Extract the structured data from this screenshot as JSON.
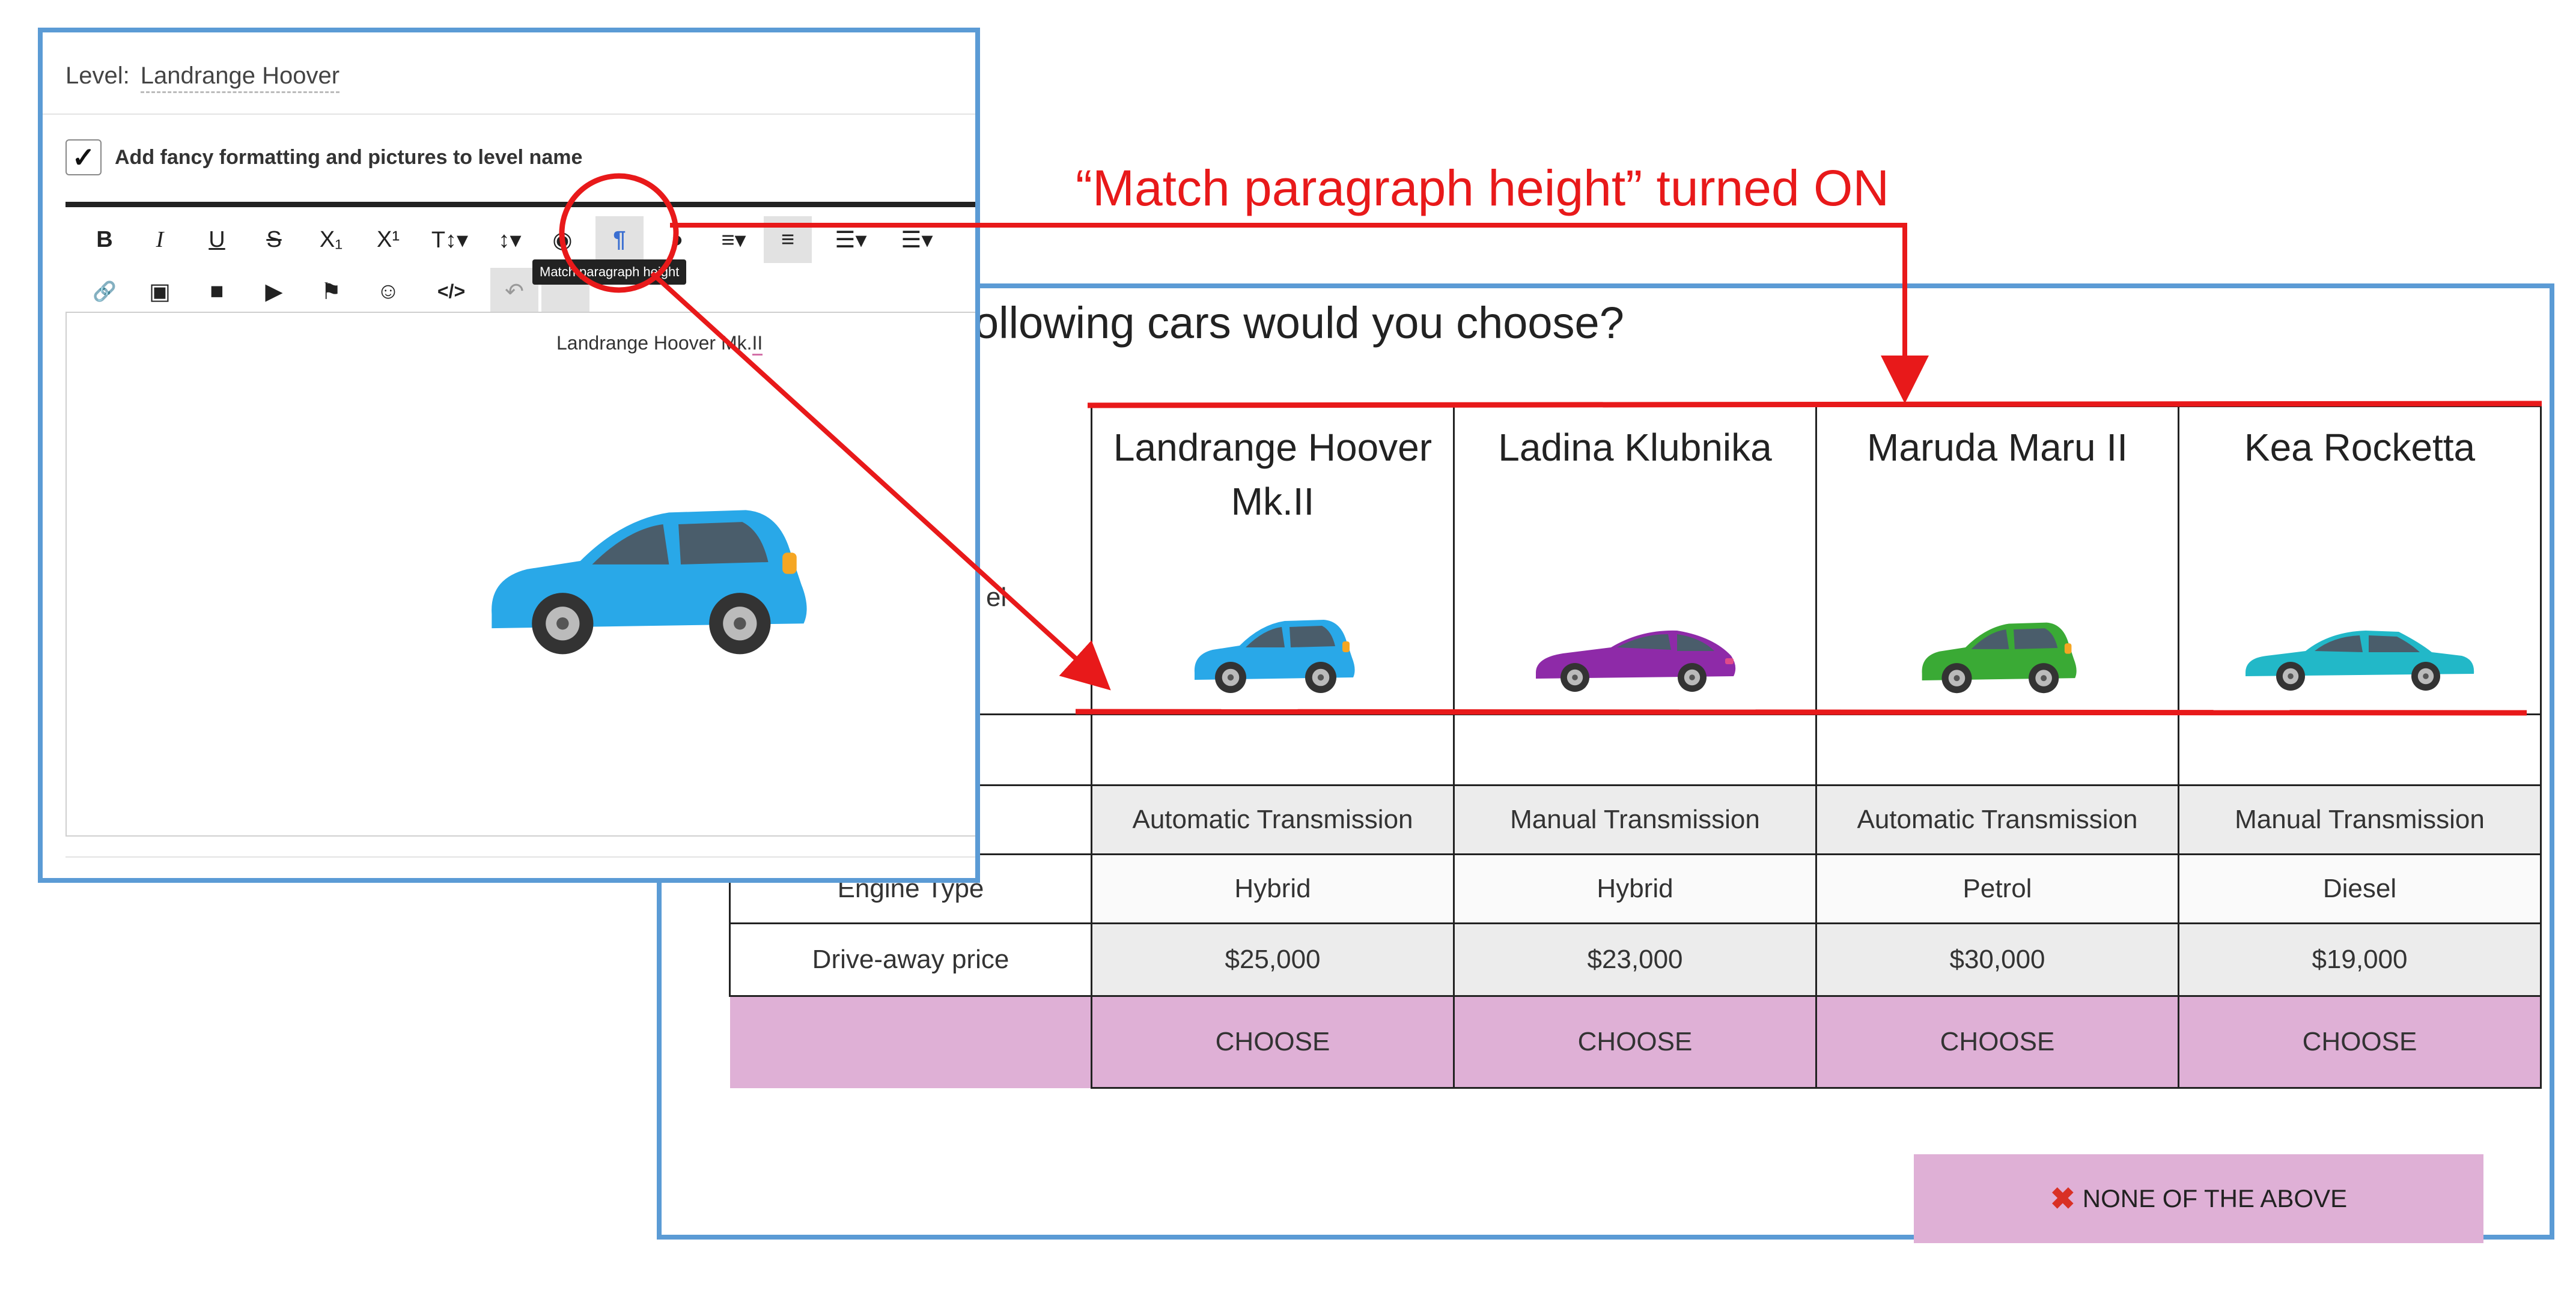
{
  "annotation": {
    "label": "“Match paragraph height” turned ON",
    "color": "#e8191a"
  },
  "editor": {
    "level_label": "Level:",
    "level_value": "Landrange Hoover",
    "fancy_checkbox_checked": true,
    "fancy_label": "Add fancy formatting and pictures to level name",
    "toolbar_row1": [
      "B",
      "I",
      "U",
      "S",
      "X₁",
      "X¹",
      "T↕▾",
      "↕▾",
      "◉",
      "¶",
      "◑",
      "≡▾",
      "≡",
      "☰▾",
      "☰▾"
    ],
    "toolbar_row2": [
      "🔗",
      "▣",
      "■",
      "▶",
      "⚑",
      "☺",
      "</>",
      "↶",
      ""
    ],
    "tooltip": "Match paragraph height",
    "caption_main": "Landrange Hoover Mk.",
    "caption_underlined": "II",
    "car_color": "#29a8e8"
  },
  "survey": {
    "question_fragment": "ollowing cars would you choose?",
    "row_label_fragment": "el",
    "columns": [
      {
        "name": "Landrange Hoover Mk.II",
        "car_color": "#29a8e8",
        "transmission": "Automatic Transmission",
        "engine": "Hybrid",
        "price": "$25,000",
        "choose": "CHOOSE"
      },
      {
        "name": "Ladina Klubnika",
        "car_color": "#8e2aa8",
        "transmission": "Manual Transmission",
        "engine": "Hybrid",
        "price": "$23,000",
        "choose": "CHOOSE"
      },
      {
        "name": "Maruda Maru II",
        "car_color": "#3aaa35",
        "transmission": "Automatic Transmission",
        "engine": "Petrol",
        "price": "$30,000",
        "choose": "CHOOSE"
      },
      {
        "name": "Kea Rocketta",
        "car_color": "#22b8c8",
        "transmission": "Manual Transmission",
        "engine": "Diesel",
        "price": "$19,000",
        "choose": "CHOOSE"
      }
    ],
    "attributes": {
      "engine_type": "Engine Type",
      "drive_away_price": "Drive-away price"
    },
    "none_button": "NONE OF THE ABOVE",
    "choose_color": "#dfb0d6"
  }
}
